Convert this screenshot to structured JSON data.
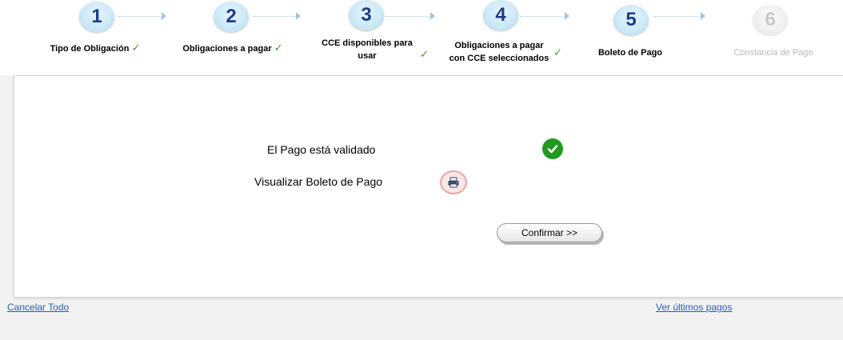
{
  "wizard": {
    "steps": [
      {
        "number": "1",
        "label": "Tipo de Obligación",
        "done": true
      },
      {
        "number": "2",
        "label": "Obligaciones a pagar",
        "done": true
      },
      {
        "number": "3",
        "label_line1": "CCE disponibles para",
        "label_line2": "usar",
        "done": true
      },
      {
        "number": "4",
        "label_line1": "Obligaciones a pagar",
        "label_line2": "con CCE seleccionados",
        "done": true
      },
      {
        "number": "5",
        "label": "Boleto de Pago",
        "done": false
      },
      {
        "number": "6",
        "label": "Constancia de Pago",
        "done": false,
        "disabled": true
      }
    ],
    "check_glyph": "✓"
  },
  "panel": {
    "validated_label": "El Pago está validado",
    "view_ticket_label": "Visualizar Boleto de Pago",
    "confirm_button": "Confirmar >>"
  },
  "footer": {
    "cancel_all": "Cancelar Todo",
    "last_payments": "Ver últimos pagos"
  },
  "colors": {
    "active_number": "#1a3d8c",
    "check": "#3a9c1c",
    "link": "#1f5fc6",
    "ok_icon": "#1f9a1f"
  },
  "icons": [
    "check-icon",
    "checkmark-ok-icon",
    "printer-icon",
    "arrow-right-icon"
  ]
}
